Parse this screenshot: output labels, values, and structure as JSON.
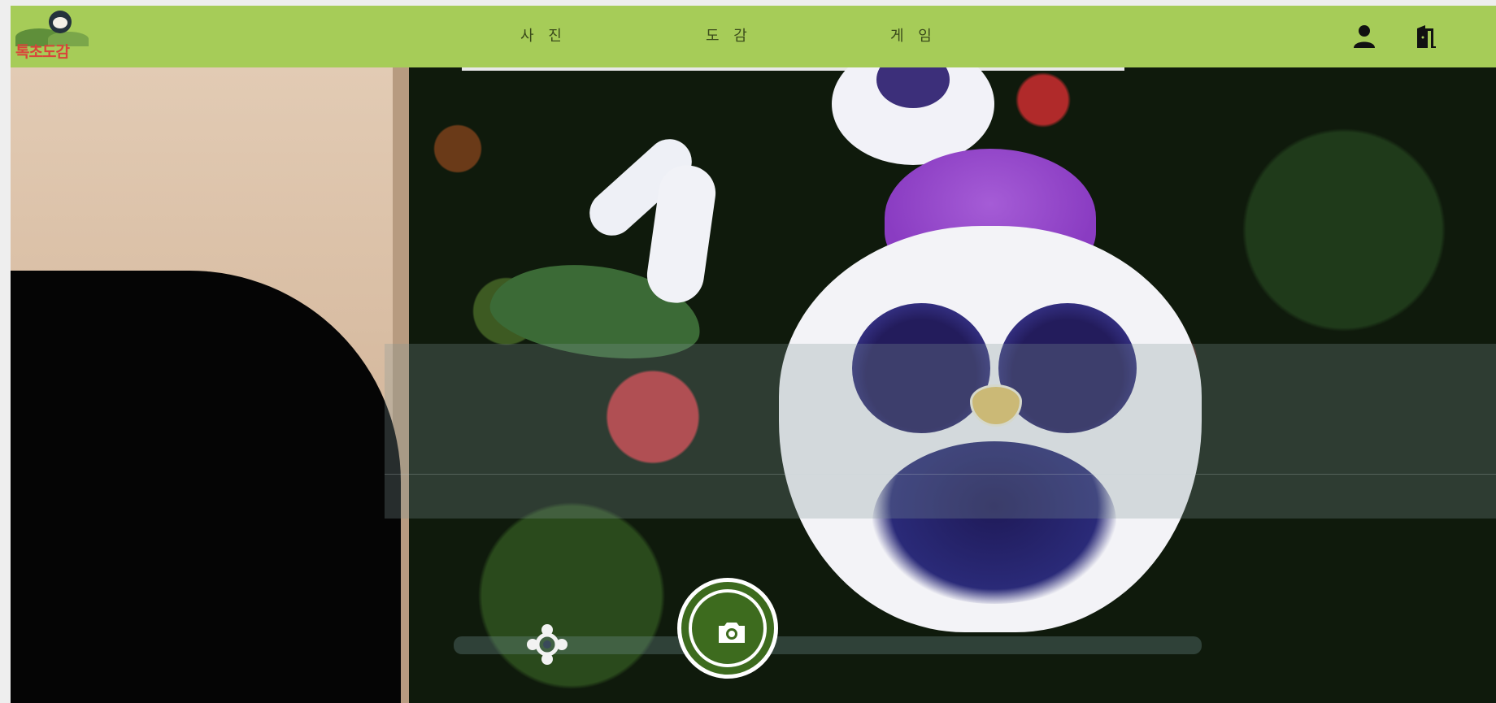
{
  "app": {
    "logo_text": "톡초도감"
  },
  "nav": {
    "photo": "사 진",
    "dict": "도 감",
    "game": "게 임"
  },
  "header_icons": {
    "user": "user-icon",
    "logout": "logout-door-icon"
  },
  "camera": {
    "shutter_icon": "camera-icon",
    "lens_icon": "lens-icon"
  },
  "colors": {
    "navbar": "#a6cc58",
    "shutter": "#3d6b1e",
    "logo_red": "#d9443a",
    "logo_green": "#3c8a3a"
  }
}
